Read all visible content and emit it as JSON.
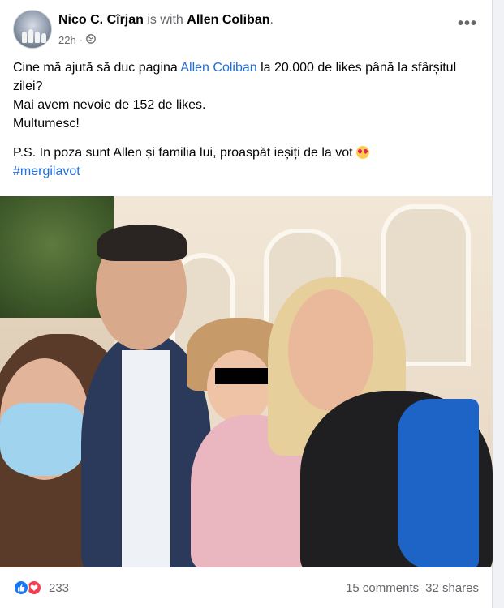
{
  "post": {
    "author": "Nico C. Cîrjan",
    "with_text": "is with",
    "tagged": "Allen Coliban",
    "tagged_suffix": ".",
    "time": "22h",
    "time_separator": "·",
    "privacy_icon": "globe-icon",
    "more_icon": "more-options-icon",
    "more_label": "•••",
    "text": {
      "line1_before": "Cine mă ajută să duc pagina ",
      "line1_link": "Allen Coliban",
      "line1_after": " la 20.000 de likes până la sfârșitul zilei?",
      "line2": "Mai avem nevoie de 152 de likes.",
      "line3": "Multumesc!",
      "ps": "P.S. In poza sunt Allen și familia lui, proaspăt ieșiți de la vot ",
      "ps_emoji": "heart-eyes-emoji",
      "hashtag": "#mergilavot"
    },
    "photo": {
      "description_icon": "post-photo"
    },
    "reactions": {
      "count": "233",
      "icons": [
        "like-icon",
        "love-icon"
      ]
    },
    "comments": "15 comments",
    "shares": "32 shares"
  },
  "colors": {
    "link": "#216fdb",
    "secondary_text": "#65676b",
    "like": "#1877f2",
    "love": "#f33e58"
  }
}
